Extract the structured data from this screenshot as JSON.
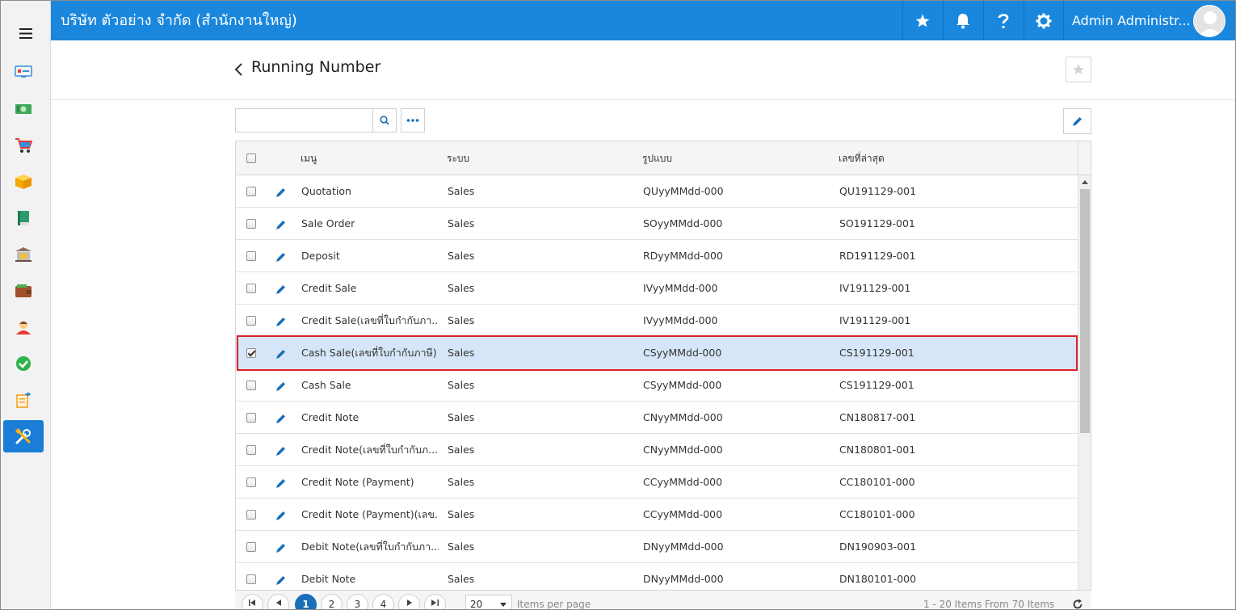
{
  "topbar": {
    "company": "บริษัท ตัวอย่าง จำกัด (สำนักงานใหญ่)",
    "user_name": "Admin Administr..."
  },
  "page": {
    "title": "Running Number"
  },
  "search": {
    "value": "",
    "placeholder": ""
  },
  "sidebar": {
    "icons": [
      "dashboard-icon",
      "money-icon",
      "cart-icon",
      "box-icon",
      "book-icon",
      "bank-icon",
      "wallet-icon",
      "person-icon",
      "approve-icon",
      "report-icon",
      "settings-tools-icon"
    ],
    "active_index": 10
  },
  "grid": {
    "columns": [
      "เมนู",
      "ระบบ",
      "รูปแบบ",
      "เลขที่ล่าสุด"
    ],
    "rows": [
      {
        "menu": "Quotation",
        "system": "Sales",
        "format": "QUyyMMdd-000",
        "latest": "QU191129-001",
        "checked": false
      },
      {
        "menu": "Sale Order",
        "system": "Sales",
        "format": "SOyyMMdd-000",
        "latest": "SO191129-001",
        "checked": false
      },
      {
        "menu": "Deposit",
        "system": "Sales",
        "format": "RDyyMMdd-000",
        "latest": "RD191129-001",
        "checked": false
      },
      {
        "menu": "Credit Sale",
        "system": "Sales",
        "format": "IVyyMMdd-000",
        "latest": "IV191129-001",
        "checked": false
      },
      {
        "menu": "Credit Sale(เลขที่ใบกำกับภา...",
        "system": "Sales",
        "format": "IVyyMMdd-000",
        "latest": "IV191129-001",
        "checked": false
      },
      {
        "menu": "Cash Sale(เลขที่ใบกำกับภาษี)",
        "system": "Sales",
        "format": "CSyyMMdd-000",
        "latest": "CS191129-001",
        "checked": true
      },
      {
        "menu": "Cash Sale",
        "system": "Sales",
        "format": "CSyyMMdd-000",
        "latest": "CS191129-001",
        "checked": false
      },
      {
        "menu": "Credit Note",
        "system": "Sales",
        "format": "CNyyMMdd-000",
        "latest": "CN180817-001",
        "checked": false
      },
      {
        "menu": "Credit Note(เลขที่ใบกำกับภ...",
        "system": "Sales",
        "format": "CNyyMMdd-000",
        "latest": "CN180801-001",
        "checked": false
      },
      {
        "menu": "Credit Note (Payment)",
        "system": "Sales",
        "format": "CCyyMMdd-000",
        "latest": "CC180101-000",
        "checked": false
      },
      {
        "menu": "Credit Note (Payment)(เลข...",
        "system": "Sales",
        "format": "CCyyMMdd-000",
        "latest": "CC180101-000",
        "checked": false
      },
      {
        "menu": "Debit Note(เลขที่ใบกำกับภา...",
        "system": "Sales",
        "format": "DNyyMMdd-000",
        "latest": "DN190903-001",
        "checked": false
      },
      {
        "menu": "Debit Note",
        "system": "Sales",
        "format": "DNyyMMdd-000",
        "latest": "DN180101-000",
        "checked": false
      }
    ],
    "selected_index": 5
  },
  "pager": {
    "pages": [
      "1",
      "2",
      "3",
      "4"
    ],
    "current_page": "1",
    "page_size": "20",
    "items_per_page_label": "Items per page",
    "info": "1 - 20 Items From 70 Items"
  },
  "colors": {
    "topbar": "#1a87dd",
    "accent": "#1a6fb8",
    "selected_row": "#d6e6f8",
    "highlight_border": "#d9222a"
  }
}
